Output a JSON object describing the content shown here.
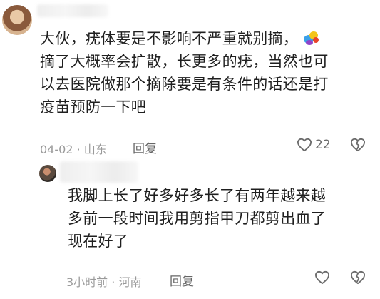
{
  "main_comment": {
    "lines": [
      "大伙，疣体要是不影响不严重就别摘，",
      "摘了大概率会扩散，长更多的疣，当然也可",
      "以去医院做那个摘除要是有条件的话还是打",
      "疫苗预防一下吧"
    ],
    "emoji_icon": "parrot-emoji-icon",
    "meta": "04-02 · 山东",
    "reply_label": "回复",
    "like_count": "22"
  },
  "reply_comment": {
    "lines": [
      "我脚上长了好多好多长了有两年越来越",
      "多前一段时间我用剪指甲刀都剪出血了",
      "现在好了"
    ],
    "meta": "3小时前 · 河南",
    "reply_label": "回复"
  },
  "colors": {
    "text": "#1f1f1f",
    "meta": "#9a9a9a",
    "icon": "#6b6b6b"
  }
}
